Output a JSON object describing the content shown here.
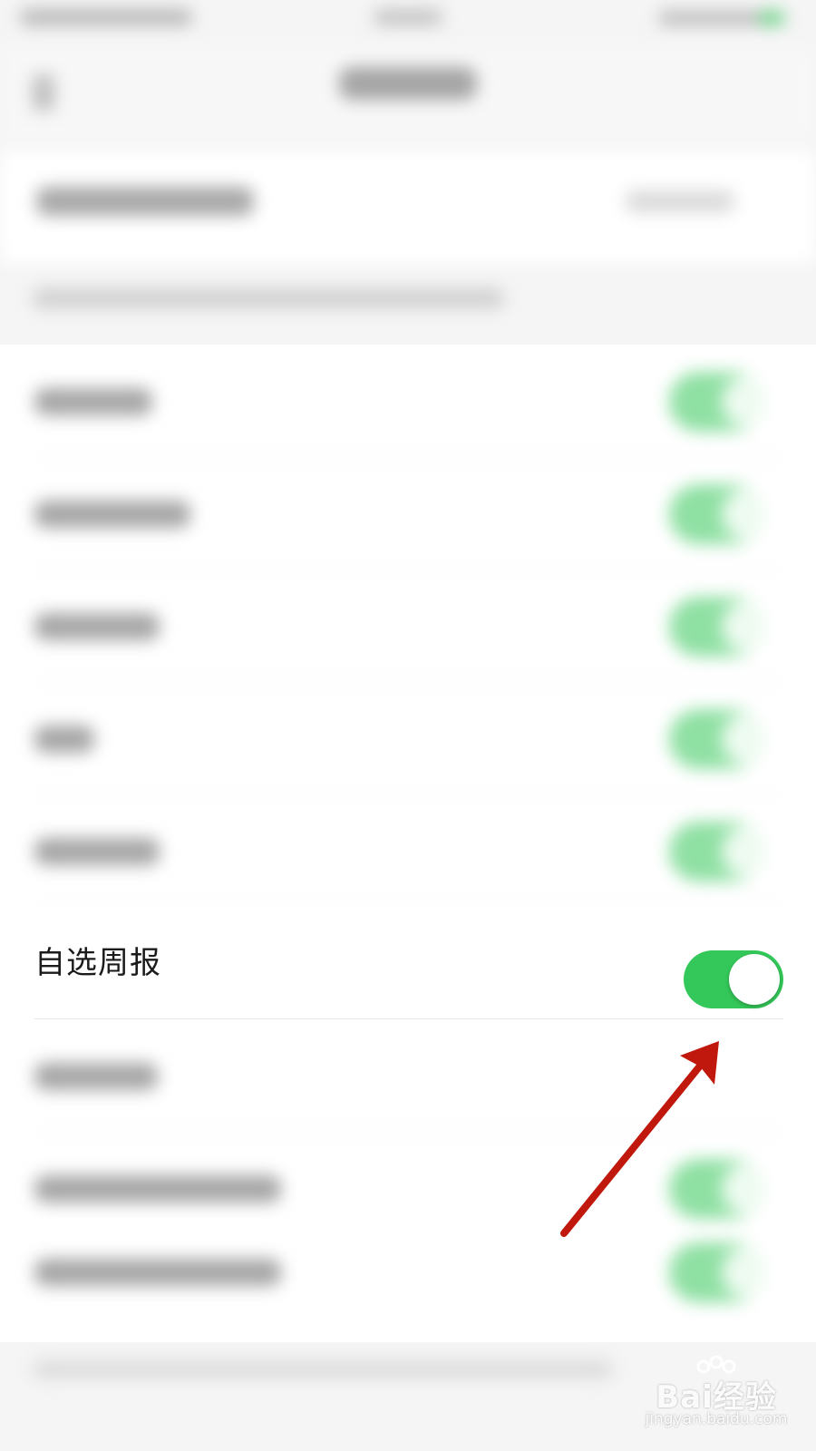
{
  "setting": {
    "label": "自选周报",
    "enabled": true
  },
  "colors": {
    "toggle_on": "#34c759",
    "arrow": "#c0180c",
    "background": "#f5f5f5"
  },
  "icons": {
    "annotation": "arrow-annotation-icon",
    "watermark": "baidu-paw-icon"
  },
  "watermark": {
    "brand": "Bai",
    "suffix": "经验",
    "url": "jingyan.baidu.com"
  }
}
